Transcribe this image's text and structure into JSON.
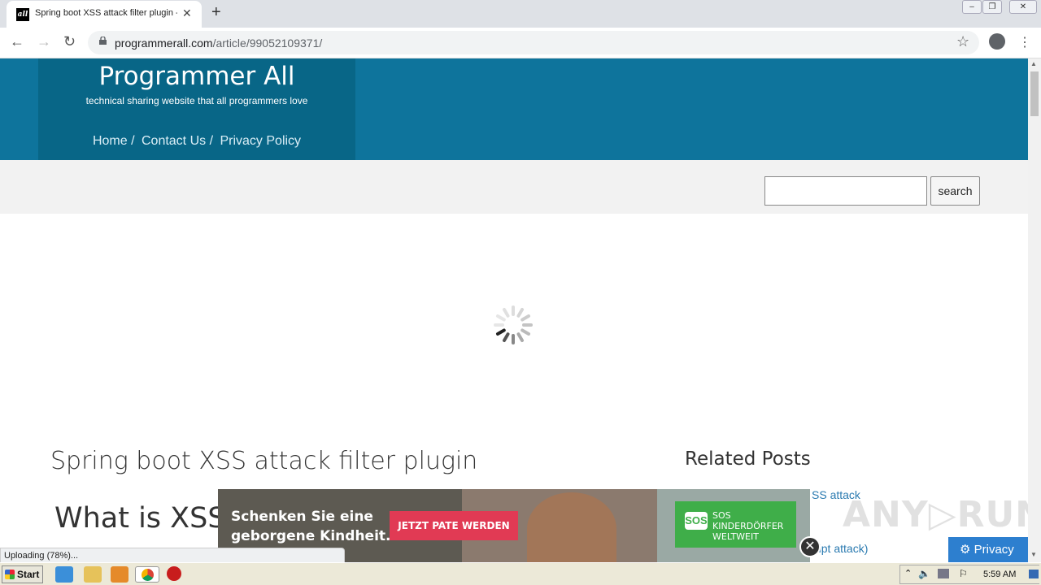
{
  "browser": {
    "tab_title": "Spring boot XSS attack filter plugin -",
    "tab_favicon_text": "all",
    "url_host": "programmerall.com",
    "url_path": "/article/99052109371/"
  },
  "site": {
    "title": "Programmer All",
    "tagline": "technical sharing website that all programmers love",
    "nav": [
      {
        "label": "Home /"
      },
      {
        "label": "Contact Us /"
      },
      {
        "label": "Privacy Policy"
      }
    ],
    "search_button": "search"
  },
  "article": {
    "title": "Spring boot XSS attack filter plugin",
    "section_heading": "What is XSS?"
  },
  "sidebar": {
    "heading": "Related Posts",
    "links": [
      {
        "label": "SS attack"
      },
      {
        "label": "cript attack)"
      }
    ]
  },
  "ad": {
    "text_line1": "Schenken Sie eine",
    "text_line2": "geborgene Kindheit.",
    "cta": "JETZT PATE WERDEN",
    "logo_mark": "SOS",
    "logo_line1": "SOS",
    "logo_line2": "KINDERDÖRFER",
    "logo_line3": "WELTWEIT",
    "close": "✕"
  },
  "overlay": {
    "watermark": "ANY▷RUN",
    "privacy_button": "Privacy",
    "status": "Uploading (78%)..."
  },
  "taskbar": {
    "start": "Start",
    "clock": "5:59 AM"
  }
}
